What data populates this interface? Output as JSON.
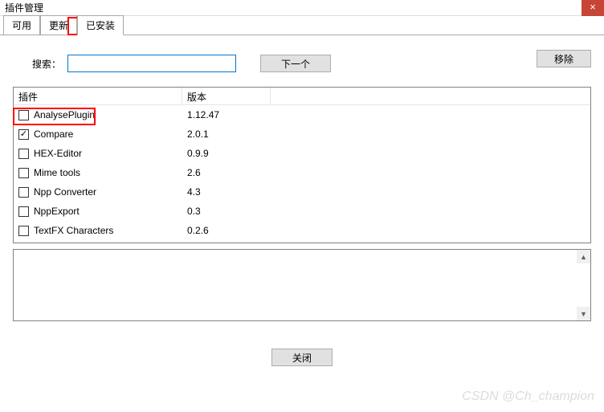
{
  "window": {
    "title": "插件管理",
    "close": "×"
  },
  "tabs": {
    "available": "可用",
    "updates": "更新",
    "installed": "已安装"
  },
  "search": {
    "label": "搜索：",
    "value": "",
    "next": "下一个",
    "remove": "移除"
  },
  "table": {
    "headers": {
      "plugin": "插件",
      "version": "版本"
    },
    "rows": [
      {
        "name": "AnalysePlugin",
        "version": "1.12.47",
        "checked": false
      },
      {
        "name": "Compare",
        "version": "2.0.1",
        "checked": true
      },
      {
        "name": "HEX-Editor",
        "version": "0.9.9",
        "checked": false
      },
      {
        "name": "Mime tools",
        "version": "2.6",
        "checked": false
      },
      {
        "name": "Npp Converter",
        "version": "4.3",
        "checked": false
      },
      {
        "name": "NppExport",
        "version": "0.3",
        "checked": false
      },
      {
        "name": "TextFX Characters",
        "version": "0.2.6",
        "checked": false
      }
    ]
  },
  "buttons": {
    "close": "关闭"
  },
  "watermark": "CSDN @Ch_champion"
}
